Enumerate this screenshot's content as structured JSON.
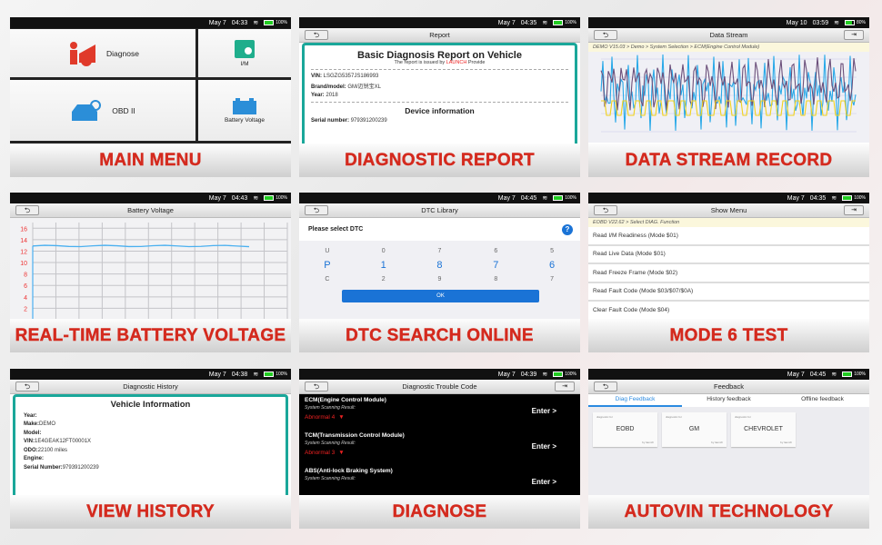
{
  "panels": {
    "main_menu": {
      "label": "MAIN MENU",
      "date": "May 7",
      "time": "04:33",
      "battery": "100%",
      "tiles": {
        "diagnose": "Diagnose",
        "im": "I/M",
        "obd": "OBD II",
        "battery": "Battery Voltage"
      }
    },
    "report": {
      "label": "DIAGNOSTIC REPORT",
      "date": "May 7",
      "time": "04:35",
      "battery": "100%",
      "title": "Report",
      "heading": "Basic Diagnosis Report on Vehicle",
      "issued_pre": "The report is issued by",
      "issued_brand": "LAUNCH",
      "issued_post": "Provide",
      "vin_k": "VIN:",
      "vin_v": "LSGZG5357JS186993",
      "brand_k": "Brand/model:",
      "brand_v": "GM/迈锐宝XL",
      "year_k": "Year:",
      "year_v": "2018",
      "device_heading": "Device information",
      "serial_k": "Serial number:",
      "serial_v": "979391200239"
    },
    "data_stream": {
      "label": "DATA STREAM RECORD",
      "date": "May 10",
      "time": "03:59",
      "battery": "80%",
      "title": "Data Stream",
      "breadcrumb": "DEMO V15.03 > Demo > System Selection > ECM(Engine Control Module)",
      "series_colors": [
        "#29a9e8",
        "#6b4f7a",
        "#f1d21d"
      ]
    },
    "battery": {
      "label": "REAL-TIME BATTERY VOLTAGE",
      "date": "May 7",
      "time": "04:43",
      "battery": "100%",
      "title": "Battery Voltage",
      "y_ticks": [
        "16",
        "14",
        "12",
        "10",
        "8",
        "6",
        "4",
        "2"
      ],
      "voltage": 12.9,
      "ylim": [
        0,
        17
      ]
    },
    "dtc": {
      "label": "DTC SEARCH ONLINE",
      "date": "May 7",
      "time": "04:45",
      "battery": "100%",
      "title": "DTC Library",
      "prompt": "Please select DTC",
      "help": "?",
      "rows": [
        [
          "U",
          "0",
          "7",
          "6",
          "5"
        ],
        [
          "P",
          "1",
          "8",
          "7",
          "6"
        ],
        [
          "C",
          "2",
          "9",
          "8",
          "7"
        ]
      ],
      "ok": "OK"
    },
    "mode6": {
      "label": "MODE 6 TEST",
      "date": "May 7",
      "time": "04:35",
      "battery": "100%",
      "title": "Show Menu",
      "breadcrumb": "EOBD V22.62 > Select DIAG. Function",
      "items": [
        "Read I/M Readiness (Mode $01)",
        "Read Live Data (Mode $01)",
        "Read Freeze Frame (Mode $02)",
        "Read Fault Code (Mode $03/$07/$0A)",
        "Clear Fault Code (Mode $04)"
      ]
    },
    "history": {
      "label": "VIEW HISTORY",
      "date": "May 7",
      "time": "04:38",
      "battery": "100%",
      "title": "Diagnostic History",
      "heading": "Vehicle Information",
      "fields": [
        {
          "k": "Year:",
          "v": ""
        },
        {
          "k": "Make:",
          "v": "DEMO"
        },
        {
          "k": "Model:",
          "v": ""
        },
        {
          "k": "VIN:",
          "v": "1E4GEAK12FT00001X"
        },
        {
          "k": "ODO:",
          "v": "22100 miles"
        },
        {
          "k": "Engine:",
          "v": ""
        },
        {
          "k": "Serial Number:",
          "v": "979391200239"
        }
      ]
    },
    "diagnose": {
      "label": "DIAGNOSE",
      "date": "May 7",
      "time": "04:39",
      "battery": "100%",
      "title": "Diagnostic Trouble Code",
      "scan_label": "System Scanning Result:",
      "enter": "Enter >",
      "modules": [
        {
          "name": "ECM(Engine Control Module)",
          "result": "Abnormal 4"
        },
        {
          "name": "TCM(Transmission Control Module)",
          "result": "Abnormal 3"
        },
        {
          "name": "ABS(Anti-lock Braking System)",
          "result": ""
        }
      ]
    },
    "autovin": {
      "label": "AUTOVIN TECHNOLOGY",
      "date": "May 7",
      "time": "04:45",
      "battery": "100%",
      "title": "Feedback",
      "tabs": [
        "Diag Feedback",
        "History feedback",
        "Offline feedback"
      ],
      "cards_top": "diagnostic for",
      "cards_bottom": "by launch",
      "cards": [
        "EOBD",
        "GM",
        "CHEVROLET"
      ]
    }
  }
}
